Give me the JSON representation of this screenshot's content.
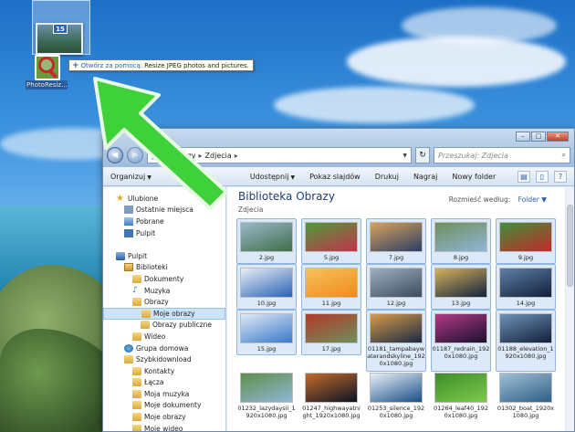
{
  "drag": {
    "badge": "15",
    "app_label": "PhotoResiz...",
    "tooltip_verb": "Otwórz za pomocą:",
    "tooltip_target": "Resize JPEG photos and pictures."
  },
  "window": {
    "breadcrumb": [
      "Obrazy",
      "Zdjecia"
    ],
    "search_placeholder": "Przeszukaj: Zdjecia",
    "commands": [
      "Organizuj",
      "Udostępnij",
      "Pokaz slajdów",
      "Drukuj",
      "Nagraj",
      "Nowy folder"
    ],
    "library_title": "Biblioteka Obrazy",
    "library_subtitle": "Zdjecia",
    "arrange_label": "Rozmieść według:",
    "arrange_value": "Folder"
  },
  "nav": [
    {
      "label": "Ulubione",
      "icon": "star-icon",
      "level": 0
    },
    {
      "label": "Ostatnie miejsca",
      "icon": "recent-places-icon",
      "level": 1
    },
    {
      "label": "Pobrane",
      "icon": "downloads-icon",
      "level": 1
    },
    {
      "label": "Pulpit",
      "icon": "desktop-icon",
      "level": 1
    },
    {
      "label": "",
      "icon": "",
      "level": 0
    },
    {
      "label": "Pulpit",
      "icon": "computer-icon",
      "level": 0
    },
    {
      "label": "Biblioteki",
      "icon": "library-icon",
      "level": 1
    },
    {
      "label": "Dokumenty",
      "icon": "documents-icon",
      "level": 2
    },
    {
      "label": "Muzyka",
      "icon": "music-icon",
      "level": 2
    },
    {
      "label": "Obrazy",
      "icon": "pictures-icon",
      "level": 2
    },
    {
      "label": "Moje obrazy",
      "icon": "folder-icon",
      "level": 3,
      "selected": true
    },
    {
      "label": "Obrazy publiczne",
      "icon": "folder-icon",
      "level": 3
    },
    {
      "label": "Wideo",
      "icon": "video-icon",
      "level": 2
    },
    {
      "label": "Grupa domowa",
      "icon": "homegroup-icon",
      "level": 1
    },
    {
      "label": "Szybkidownload",
      "icon": "user-folder-icon",
      "level": 1
    },
    {
      "label": "Kontakty",
      "icon": "folder-icon",
      "level": 2
    },
    {
      "label": "Łącza",
      "icon": "folder-icon",
      "level": 2
    },
    {
      "label": "Moja muzyka",
      "icon": "folder-icon",
      "level": 2
    },
    {
      "label": "Moje dokumenty",
      "icon": "folder-icon",
      "level": 2
    },
    {
      "label": "Moje obrazy",
      "icon": "folder-icon",
      "level": 2
    },
    {
      "label": "Moje wideo",
      "icon": "folder-icon",
      "level": 2
    }
  ],
  "files": [
    {
      "name": "2.jpg",
      "selected": true,
      "colors": [
        "#3f6f4a",
        "#9ab7c9"
      ]
    },
    {
      "name": "5.jpg",
      "selected": true,
      "colors": [
        "#c4334a",
        "#4f9a3c"
      ]
    },
    {
      "name": "7.jpg",
      "selected": true,
      "colors": [
        "#2c3e66",
        "#d7a25c"
      ]
    },
    {
      "name": "8.jpg",
      "selected": true,
      "colors": [
        "#8fb6d6",
        "#6f8f5c"
      ]
    },
    {
      "name": "9.jpg",
      "selected": true,
      "colors": [
        "#c42a2a",
        "#3f8f3a"
      ]
    },
    {
      "name": "10.jpg",
      "selected": true,
      "colors": [
        "#2a63b5",
        "#e8eef5"
      ]
    },
    {
      "name": "11.jpg",
      "selected": true,
      "colors": [
        "#f08a1e",
        "#f6c25a"
      ]
    },
    {
      "name": "12.jpg",
      "selected": true,
      "colors": [
        "#3b4b5e",
        "#9fb0c2"
      ]
    },
    {
      "name": "13.jpg",
      "selected": true,
      "colors": [
        "#12233d",
        "#d8b25c"
      ]
    },
    {
      "name": "14.jpg",
      "selected": true,
      "colors": [
        "#10203a",
        "#5f7fa8"
      ]
    },
    {
      "name": "15.jpg",
      "selected": true,
      "colors": [
        "#3a79c9",
        "#dfe9f4"
      ]
    },
    {
      "name": "17.jpg",
      "selected": true,
      "colors": [
        "#6f8f5c",
        "#b23a2a"
      ]
    },
    {
      "name": "01181_tampabaywaterandskyline_1920x1080.jpg",
      "selected": true,
      "colors": [
        "#1b2b44",
        "#d79a4a"
      ]
    },
    {
      "name": "01187_redrain_1920x1080.jpg",
      "selected": true,
      "colors": [
        "#1b1030",
        "#b23a86"
      ]
    },
    {
      "name": "01188_elevation_1920x1080.jpg",
      "selected": true,
      "colors": [
        "#10203a",
        "#6f93b8"
      ]
    },
    {
      "name": "01232_lazydaysii_1920x1080.jpg",
      "selected": false,
      "colors": [
        "#8fb6d6",
        "#5f8f4c"
      ]
    },
    {
      "name": "01247_highwayatnight_1920x1080.jpg",
      "selected": false,
      "colors": [
        "#0c1424",
        "#c46a2a"
      ]
    },
    {
      "name": "01253_silence_1920x1080.jpg",
      "selected": false,
      "colors": [
        "#1a4f86",
        "#e8f0f8"
      ]
    },
    {
      "name": "01264_leaf40_1920x1080.jpg",
      "selected": false,
      "colors": [
        "#7fc84a",
        "#3b8f2a"
      ]
    },
    {
      "name": "01302_boat_1920x1080.jpg",
      "selected": false,
      "colors": [
        "#2f5f86",
        "#9fbfd6"
      ]
    }
  ]
}
